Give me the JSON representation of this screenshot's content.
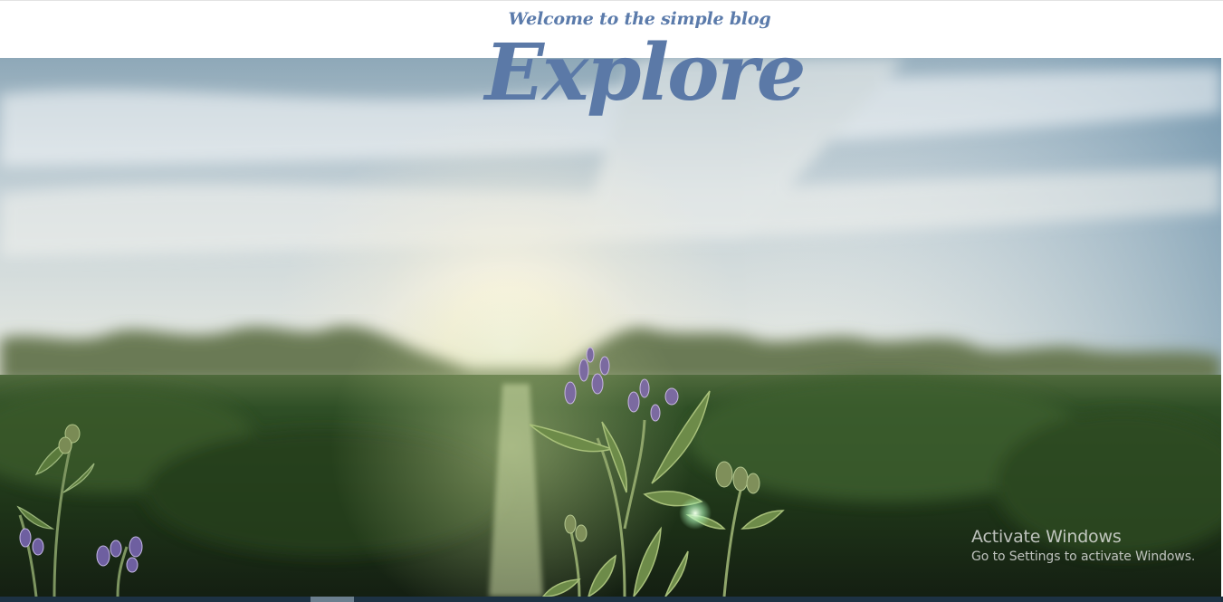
{
  "header": {
    "subtitle": "Welcome to the simple blog",
    "title": "Explore"
  },
  "hero": {
    "image_description": "hero-meadow-sunset-photo"
  },
  "watermark": {
    "title": "Activate Windows",
    "subtitle": "Go to Settings to activate Windows."
  },
  "colors": {
    "heading": "#5b79a7",
    "taskbar": "#1d3244"
  }
}
